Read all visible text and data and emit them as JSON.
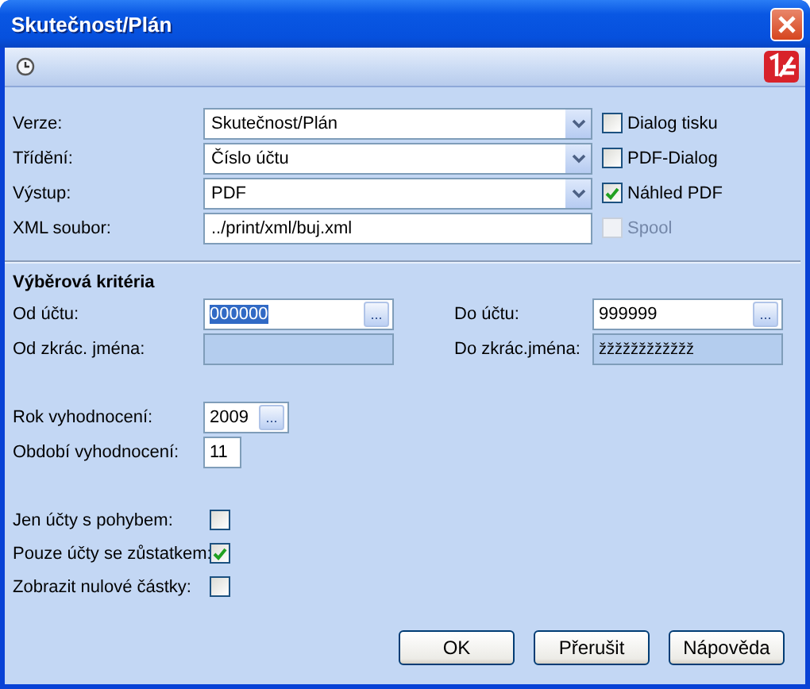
{
  "window": {
    "title": "Skutečnost/Plán"
  },
  "settings": [
    {
      "label": "Verze:",
      "kind": "combo",
      "value": "Skutečnost/Plán",
      "option": {
        "label": "Dialog tisku",
        "checked": false,
        "disabled": false
      }
    },
    {
      "label": "Třídění:",
      "kind": "combo",
      "value": "Číslo účtu",
      "option": {
        "label": "PDF-Dialog",
        "checked": false,
        "disabled": false
      }
    },
    {
      "label": "Výstup:",
      "kind": "combo",
      "value": "PDF",
      "option": {
        "label": "Náhled PDF",
        "checked": true,
        "disabled": false
      }
    },
    {
      "label": "XML soubor:",
      "kind": "text",
      "value": "../print/xml/buj.xml",
      "option": {
        "label": "Spool",
        "checked": false,
        "disabled": true
      }
    }
  ],
  "criteria": {
    "title": "Výběrová kritéria",
    "range": [
      {
        "from": {
          "label": "Od účtu:",
          "kind": "lookup",
          "value": "000000",
          "button": "...",
          "highlighted": true
        },
        "to": {
          "label": "Do účtu:",
          "kind": "lookup",
          "value": "999999",
          "button": "...",
          "highlighted": false
        }
      },
      {
        "from": {
          "label": "Od zkrác. jména:",
          "kind": "readonly"
        },
        "to": {
          "label": "Do zkrác.jména:",
          "kind": "readonly",
          "value": "žžžžžžžžžžžž"
        }
      }
    ],
    "period": [
      {
        "label": "Rok vyhodnocení:",
        "kind": "lookup",
        "value": "2009",
        "button": "..."
      },
      {
        "label": "Období vyhodnocení:",
        "kind": "text",
        "value": "11"
      }
    ],
    "flags": [
      {
        "label": "Jen účty s pohybem:",
        "checked": false
      },
      {
        "label": "Pouze účty se zůstatkem:",
        "checked": true
      },
      {
        "label": "Zobrazit nulové částky:",
        "checked": false
      }
    ]
  },
  "buttons": [
    "OK",
    "Přerušit",
    "Nápověda"
  ]
}
